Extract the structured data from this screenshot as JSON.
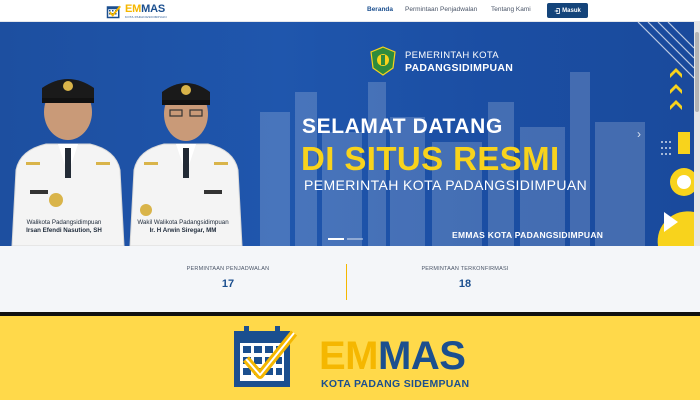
{
  "navbar": {
    "brand_em": "EM",
    "brand_mas": "MAS",
    "brand_sub": "KOTA PADANGSIDIMPUAN",
    "links": [
      "Beranda",
      "Permintaan Penjadwalan",
      "Tentang Kami"
    ],
    "login_label": "Masuk",
    "login_icon": "login-icon"
  },
  "hero": {
    "gov_line1": "PEMERINTAH KOTA",
    "gov_line2": "PADANGSIDIMPUAN",
    "welcome_1": "SELAMAT DATANG",
    "welcome_2": "DI SITUS RESMI",
    "welcome_3": "PEMERINTAH KOTA PADANGSIDIMPUAN",
    "footer": "EMMAS KOTA PADANGSIDIMPUAN",
    "officials": [
      {
        "title": "Walikota Padangsidimpuan",
        "name": "Irsan Efendi Nasution, SH"
      },
      {
        "title": "Wakil Walikota Padangsidimpuan",
        "name": "Ir. H Arwin Siregar, MM"
      }
    ],
    "next_icon": "chevron-right-icon"
  },
  "stats": [
    {
      "label": "PERMINTAAN PENJADWALAN",
      "value": "17"
    },
    {
      "label": "PERMINTAAN TERKONFIRMASI",
      "value": "18"
    }
  ],
  "band": {
    "word_em": "EM",
    "word_mas": "MAS",
    "sub": "KOTA PADANG SIDEMPUAN"
  },
  "colors": {
    "brand_blue": "#1b4f8f",
    "brand_yellow": "#f5b700",
    "hero_blue": "#1f56ad",
    "band_yellow": "#ffd94a"
  }
}
